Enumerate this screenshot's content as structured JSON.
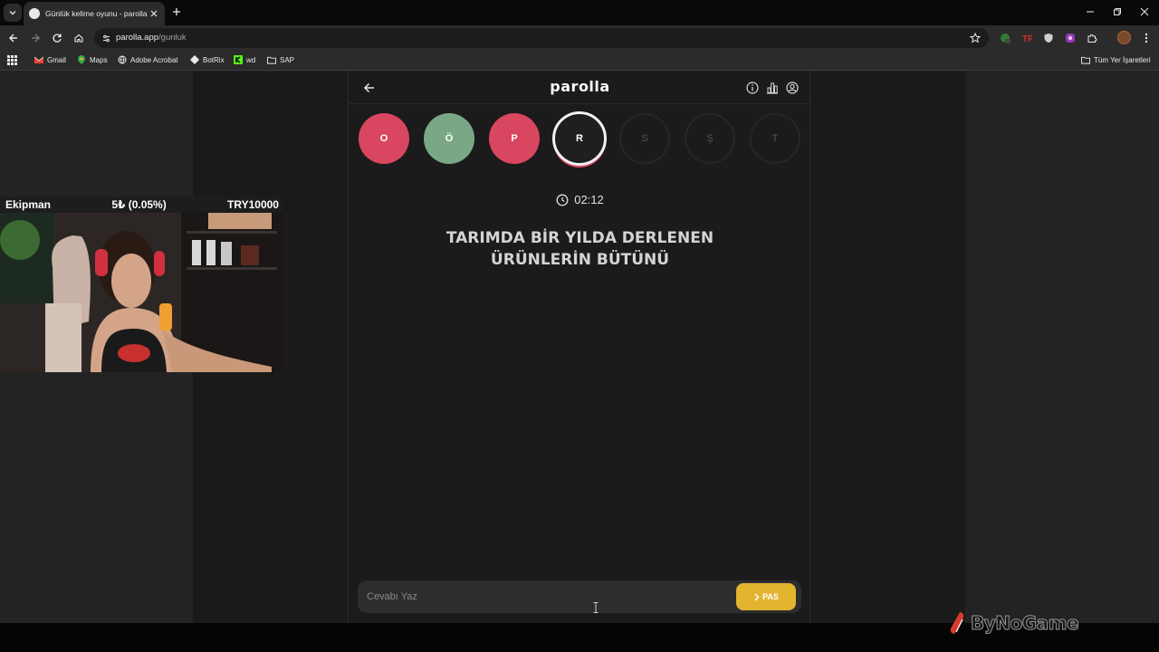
{
  "browser": {
    "tab_title": "Günlük kelime oyunu - parolla",
    "url_host": "parolla.app",
    "url_path": "/gunluk",
    "bookmarks": [
      "Gmail",
      "Maps",
      "Adobe Acrobat",
      "BotRix",
      "wd",
      "SAP"
    ],
    "all_bookmarks": "Tüm Yer İşaretleri"
  },
  "app": {
    "logo": "parolla",
    "letters": [
      {
        "char": "O",
        "state": "wrong"
      },
      {
        "char": "Ö",
        "state": "right"
      },
      {
        "char": "P",
        "state": "wrong"
      },
      {
        "char": "R",
        "state": "active"
      },
      {
        "char": "S",
        "state": "pending"
      },
      {
        "char": "Ş",
        "state": "pending"
      },
      {
        "char": "T",
        "state": "pending"
      }
    ],
    "timer": "02:12",
    "question_line1": "TARIMDA BİR YILDA DERLENEN",
    "question_line2": "ÜRÜNLERİN BÜTÜNÜ",
    "answer_placeholder": "Cevabı Yaz",
    "pass_label": "PAS"
  },
  "overlay": {
    "name": "Ekipman",
    "percent": "5₺ (0.05%)",
    "goal": "TRY10000",
    "watermark": "ByNoGame"
  },
  "colors": {
    "wrong": "#d9465f",
    "right": "#7aa886",
    "pass_button": "#e3b52f"
  }
}
